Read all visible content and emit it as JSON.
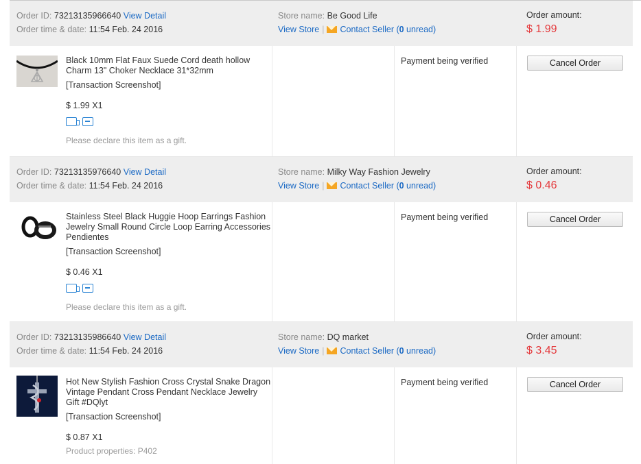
{
  "labels": {
    "order_id": "Order ID:",
    "order_time": "Order time & date:",
    "store_name": "Store name:",
    "view_detail": "View Detail",
    "view_store": "View Store",
    "contact_seller_prefix": "Contact Seller (",
    "contact_seller_suffix": " unread)",
    "order_amount": "Order amount:",
    "transaction_screenshot": "[Transaction Screenshot]",
    "cancel_order": "Cancel Order",
    "separator": "|"
  },
  "orders": [
    {
      "order_id": "73213135966640",
      "datetime": "11:54 Feb. 24 2016",
      "store_name": "Be Good Life",
      "unread": "0",
      "amount": "$ 1.99",
      "item_title": "Black 10mm Flat Faux Suede Cord death hollow Charm 13\" Choker Necklace 31*32mm",
      "price_qty": "$ 1.99 X1",
      "note": "Please declare this item as a gift.",
      "status": "Payment being verified",
      "image": "choker-necklace-thumbnail"
    },
    {
      "order_id": "73213135976640",
      "datetime": "11:54 Feb. 24 2016",
      "store_name": "Milky Way Fashion Jewelry",
      "unread": "0",
      "amount": "$ 0.46",
      "item_title": "Stainless Steel Black Huggie Hoop Earrings Fashion Jewelry Small Round Circle Loop Earring Accessories Pendientes",
      "price_qty": "$ 0.46 X1",
      "note": "Please declare this item as a gift.",
      "status": "Payment being verified",
      "image": "hoop-earrings-thumbnail"
    },
    {
      "order_id": "73213135986640",
      "datetime": "11:54 Feb. 24 2016",
      "store_name": "DQ market",
      "unread": "0",
      "amount": "$ 3.45",
      "item_title": "Hot New Stylish Fashion Cross Crystal Snake Dragon Vintage Pendant Cross Pendant Necklace Jewelry Gift #DQlyt",
      "price_qty": "$ 0.87 X1",
      "note": "Product properties: P402",
      "status": "Payment being verified",
      "image": "cross-pendant-thumbnail"
    }
  ],
  "icons": [
    "shipping-truck-icon",
    "return-policy-icon",
    "mail-icon"
  ],
  "colors": {
    "link": "#1a69c4",
    "amount": "#e4393c",
    "header_bg": "#eeeeee",
    "icon_blue": "#2b84d4",
    "mail": "#f5a623"
  }
}
